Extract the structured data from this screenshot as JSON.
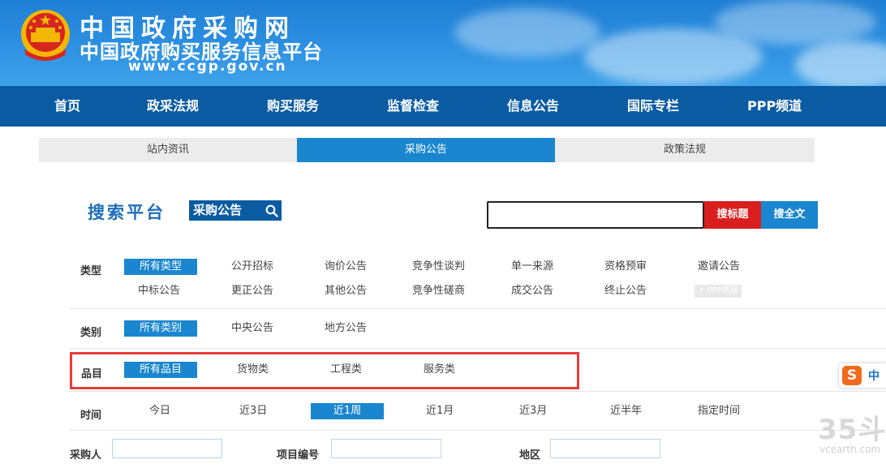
{
  "header": {
    "title": "中国政府采购网",
    "subtitle": "中国政府购买服务信息平台",
    "url": "www.ccgp.gov.cn"
  },
  "nav": [
    "首页",
    "政采法规",
    "购买服务",
    "监督检查",
    "信息公告",
    "国际专栏",
    "PPP频道"
  ],
  "subtabs": {
    "items": [
      "站内资讯",
      "采购公告",
      "政策法规"
    ],
    "active": "采购公告"
  },
  "search": {
    "platform_title": "搜索平台",
    "badge": "采购公告",
    "input_value": "",
    "btn_title": "搜标题",
    "btn_full": "搜全文"
  },
  "filters": {
    "type": {
      "label": "类型",
      "row1": [
        "所有类型",
        "公开招标",
        "询价公告",
        "竞争性谈判",
        "单一来源",
        "资格预审",
        "邀请公告"
      ],
      "row2": [
        "中标公告",
        "更正公告",
        "其他公告",
        "竞争性磋商",
        "成交公告",
        "终止公告"
      ],
      "ppp": "✓ PPP项目",
      "selected": "所有类型"
    },
    "category": {
      "label": "类别",
      "options": [
        "所有类别",
        "中央公告",
        "地方公告"
      ],
      "selected": "所有类别"
    },
    "item": {
      "label": "品目",
      "options": [
        "所有品目",
        "货物类",
        "工程类",
        "服务类"
      ],
      "selected": "所有品目"
    },
    "time": {
      "label": "时间",
      "options": [
        "今日",
        "近3日",
        "近1周",
        "近1月",
        "近3月",
        "近半年",
        "指定时间"
      ],
      "selected": "近1周"
    }
  },
  "fields": {
    "buyer": "采购人",
    "project_no": "项目编号",
    "region": "地区"
  },
  "widgets": {
    "ime_logo": "S",
    "ime_lang": "中",
    "watermark": "35斗",
    "watermark_url": "vcearth.com"
  },
  "colors": {
    "primary": "#1a86cf",
    "nav": "#0b5ba3",
    "red": "#d91e1e",
    "highlight": "#ea3b3b"
  }
}
